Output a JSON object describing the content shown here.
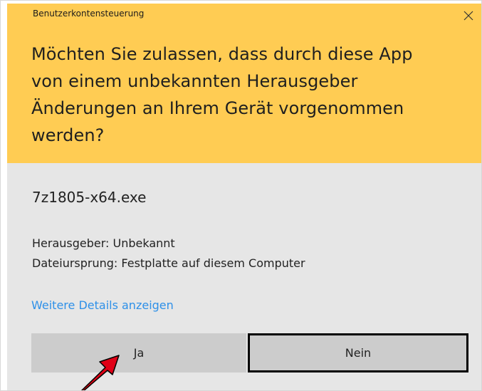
{
  "dialog": {
    "title": "Benutzerkontensteuerung",
    "headline": "Möchten Sie zulassen, dass durch diese App\nvon einem unbekannten Herausgeber\nÄnderungen an Ihrem Gerät vorgenommen\nwerden?",
    "program_name": "7z1805-x64.exe",
    "publisher_line": "Herausgeber: Unbekannt",
    "origin_line": "Dateiursprung: Festplatte auf diesem Computer",
    "more_details_link": "Weitere Details anzeigen",
    "buttons": {
      "yes": "Ja",
      "no": "Nein"
    }
  },
  "colors": {
    "header_bg": "#ffcc53",
    "body_bg": "#e6e6e6",
    "link": "#2e90e8",
    "annotation_arrow": "#e00016"
  },
  "icons": {
    "close": "close-icon",
    "annotation": "annotation-arrow"
  }
}
